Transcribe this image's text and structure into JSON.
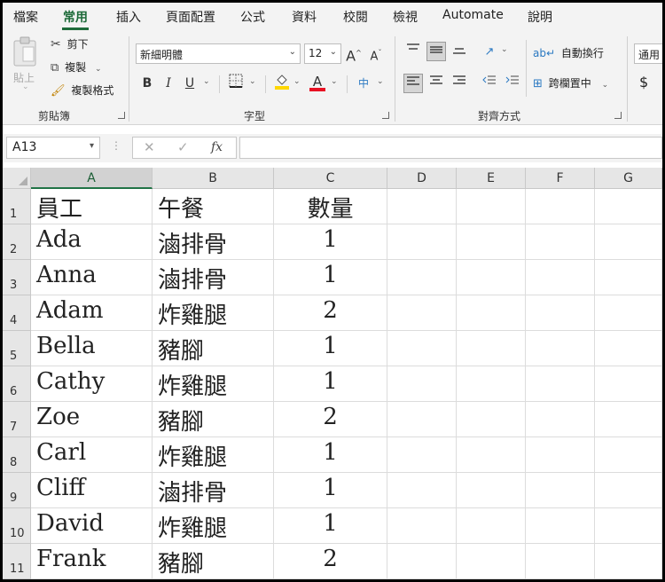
{
  "tabs": [
    "檔案",
    "常用",
    "插入",
    "頁面配置",
    "公式",
    "資料",
    "校閱",
    "檢視",
    "Automate",
    "說明"
  ],
  "active_tab": "常用",
  "clipboard": {
    "paste": "貼上",
    "cut": "剪下",
    "copy": "複製",
    "format_painter": "複製格式",
    "group_label": "剪貼簿"
  },
  "font": {
    "font_name": "新細明體",
    "font_size": "12",
    "grow": "A",
    "shrink": "A",
    "bold": "B",
    "italic": "I",
    "underline": "U",
    "font_color_glyph": "A",
    "phonetic_glyph": "中",
    "group_label": "字型"
  },
  "alignment": {
    "wrap_text": "自動換行",
    "merge_center": "跨欄置中",
    "group_label": "對齊方式"
  },
  "number": {
    "format": "通用",
    "currency": "$"
  },
  "formula_bar": {
    "name_box": "A13",
    "fx": "fx",
    "value": ""
  },
  "colors": {
    "accent": "#1e6b3a",
    "fill_yellow": "#ffd700",
    "font_red": "#e81123"
  },
  "sheet": {
    "columns": [
      "A",
      "B",
      "C",
      "D",
      "E",
      "F",
      "G"
    ],
    "rows": [
      {
        "n": "1",
        "a": "員工",
        "b": "午餐",
        "c": "數量"
      },
      {
        "n": "2",
        "a": "Ada",
        "b": "滷排骨",
        "c": "1"
      },
      {
        "n": "3",
        "a": "Anna",
        "b": "滷排骨",
        "c": "1"
      },
      {
        "n": "4",
        "a": "Adam",
        "b": "炸雞腿",
        "c": "2"
      },
      {
        "n": "5",
        "a": "Bella",
        "b": "豬腳",
        "c": "1"
      },
      {
        "n": "6",
        "a": "Cathy",
        "b": "炸雞腿",
        "c": "1"
      },
      {
        "n": "7",
        "a": "Zoe",
        "b": "豬腳",
        "c": "2"
      },
      {
        "n": "8",
        "a": "Carl",
        "b": "炸雞腿",
        "c": "1"
      },
      {
        "n": "9",
        "a": "Cliff",
        "b": "滷排骨",
        "c": "1"
      },
      {
        "n": "10",
        "a": "David",
        "b": "炸雞腿",
        "c": "1"
      },
      {
        "n": "11",
        "a": "Frank",
        "b": "豬腳",
        "c": "2"
      }
    ]
  }
}
